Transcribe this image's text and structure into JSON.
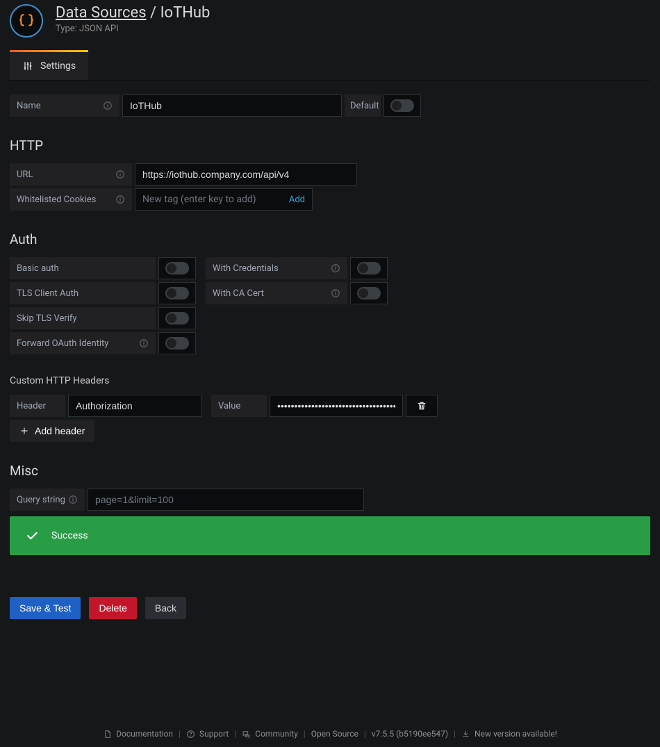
{
  "header": {
    "breadcrumb_root": "Data Sources",
    "breadcrumb_sep": " / ",
    "breadcrumb_current": "IoTHub",
    "subtype_prefix": "Type: ",
    "subtype": "JSON API"
  },
  "tabs": {
    "settings": "Settings"
  },
  "fields": {
    "name_label": "Name",
    "name_value": "IoTHub",
    "default_label": "Default"
  },
  "http": {
    "title": "HTTP",
    "url_label": "URL",
    "url_value": "https://iothub.company.com/api/v4",
    "cookies_label": "Whitelisted Cookies",
    "cookies_placeholder": "New tag (enter key to add)",
    "cookies_add": "Add"
  },
  "auth": {
    "title": "Auth",
    "basic": "Basic auth",
    "with_credentials": "With Credentials",
    "tls_client": "TLS Client Auth",
    "with_ca": "With CA Cert",
    "skip_tls": "Skip TLS Verify",
    "forward_oauth": "Forward OAuth Identity"
  },
  "headers": {
    "title": "Custom HTTP Headers",
    "header_label": "Header",
    "header_value": "Authorization",
    "value_label": "Value",
    "value_masked": "•••••••••••••••••••••••••••••••••••••••…",
    "add_btn": "Add header"
  },
  "misc": {
    "title": "Misc",
    "qs_label": "Query string",
    "qs_placeholder": "page=1&limit=100"
  },
  "alert": {
    "text": "Success"
  },
  "actions": {
    "save": "Save & Test",
    "delete": "Delete",
    "back": "Back"
  },
  "footer": {
    "docs": "Documentation",
    "support": "Support",
    "community": "Community",
    "opensource": "Open Source",
    "version": "v7.5.5 (b5190ee547)",
    "update": "New version available!"
  }
}
